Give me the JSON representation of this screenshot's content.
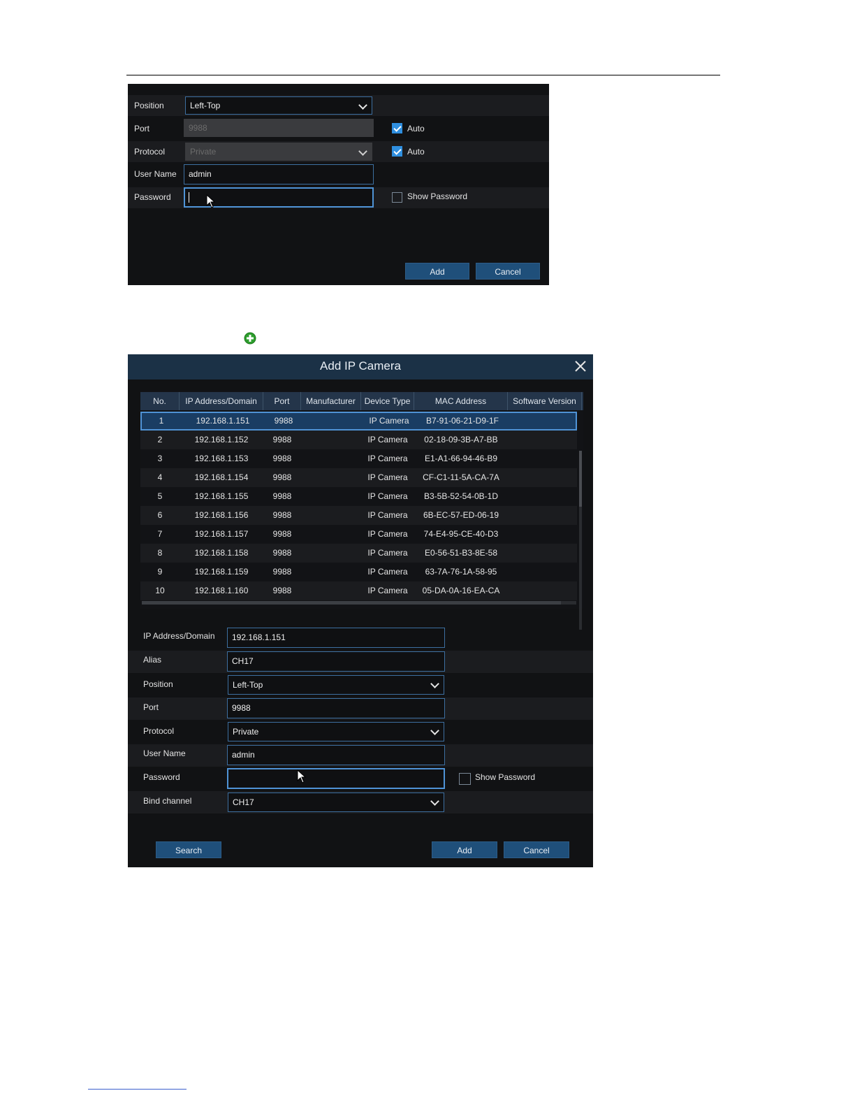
{
  "panel1": {
    "rows": {
      "position": {
        "label": "Position",
        "value": "Left-Top"
      },
      "port": {
        "label": "Port",
        "value": "9988",
        "auto_label": "Auto"
      },
      "protocol": {
        "label": "Protocol",
        "value": "Private",
        "auto_label": "Auto"
      },
      "username": {
        "label": "User Name",
        "value": "admin"
      },
      "password": {
        "label": "Password",
        "value": "",
        "show_label": "Show Password"
      }
    },
    "add_label": "Add",
    "cancel_label": "Cancel"
  },
  "dialog": {
    "title": "Add IP Camera",
    "table": {
      "columns": [
        "No.",
        "IP Address/Domain",
        "Port",
        "Manufacturer",
        "Device Type",
        "MAC Address",
        "Software Version"
      ],
      "rows": [
        [
          "1",
          "192.168.1.151",
          "9988",
          "",
          "IP Camera",
          "B7-91-06-21-D9-1F",
          ""
        ],
        [
          "2",
          "192.168.1.152",
          "9988",
          "",
          "IP Camera",
          "02-18-09-3B-A7-BB",
          ""
        ],
        [
          "3",
          "192.168.1.153",
          "9988",
          "",
          "IP Camera",
          "E1-A1-66-94-46-B9",
          ""
        ],
        [
          "4",
          "192.168.1.154",
          "9988",
          "",
          "IP Camera",
          "CF-C1-11-5A-CA-7A",
          ""
        ],
        [
          "5",
          "192.168.1.155",
          "9988",
          "",
          "IP Camera",
          "B3-5B-52-54-0B-1D",
          ""
        ],
        [
          "6",
          "192.168.1.156",
          "9988",
          "",
          "IP Camera",
          "6B-EC-57-ED-06-19",
          ""
        ],
        [
          "7",
          "192.168.1.157",
          "9988",
          "",
          "IP Camera",
          "74-E4-95-CE-40-D3",
          ""
        ],
        [
          "8",
          "192.168.1.158",
          "9988",
          "",
          "IP Camera",
          "E0-56-51-B3-8E-58",
          ""
        ],
        [
          "9",
          "192.168.1.159",
          "9988",
          "",
          "IP Camera",
          "63-7A-76-1A-58-95",
          ""
        ],
        [
          "10",
          "192.168.1.160",
          "9988",
          "",
          "IP Camera",
          "05-DA-0A-16-EA-CA",
          ""
        ]
      ],
      "selected_row": 1
    },
    "form": {
      "ip": {
        "label": "IP Address/Domain",
        "value": "192.168.1.151"
      },
      "alias": {
        "label": "Alias",
        "value": "CH17"
      },
      "position": {
        "label": "Position",
        "value": "Left-Top"
      },
      "port": {
        "label": "Port",
        "value": "9988"
      },
      "protocol": {
        "label": "Protocol",
        "value": "Private"
      },
      "username": {
        "label": "User Name",
        "value": "admin"
      },
      "password": {
        "label": "Password",
        "value": "",
        "show_label": "Show Password"
      },
      "bind": {
        "label": "Bind channel",
        "value": "CH17"
      }
    },
    "search_label": "Search",
    "add_label": "Add",
    "cancel_label": "Cancel"
  },
  "colors": {
    "panel_bg": "#111214",
    "accent": "#4f93d6",
    "button": "#1f4f7a",
    "add_icon": "#2e9e2e"
  },
  "icons": {
    "add": "plus-circle-icon",
    "close": "close-icon",
    "dropdown": "chevron-down-icon",
    "cursor": "mouse-pointer-icon"
  }
}
